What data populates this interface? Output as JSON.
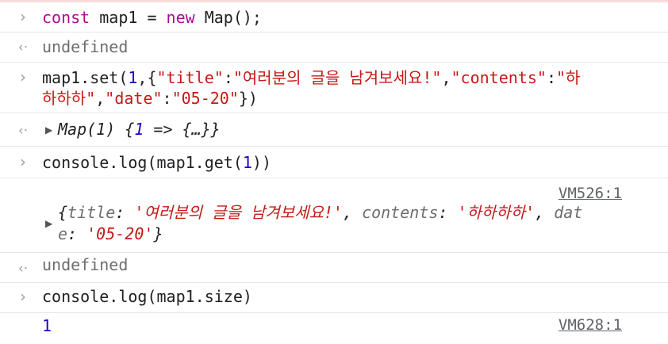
{
  "rows": [
    {
      "type": "input",
      "text_parts": [
        "const",
        " map1 = ",
        "new",
        " Map();"
      ]
    },
    {
      "type": "output",
      "text": "undefined"
    },
    {
      "type": "input",
      "line1_parts": [
        "map1.set(",
        "1",
        ",{",
        "\"title\"",
        ":",
        "\"여러분의 글을 남겨보세요!\"",
        ",",
        "\"contents\"",
        ":",
        "\"하"
      ],
      "line2_parts": [
        "하하하\"",
        ",",
        "\"date\"",
        ":",
        "\"05-20\"",
        "})"
      ]
    },
    {
      "type": "output",
      "parts": [
        "Map(1) {",
        "1",
        " => {…}}"
      ]
    },
    {
      "type": "input",
      "parts": [
        "console.log(map1.get(",
        "1",
        "))"
      ]
    },
    {
      "type": "log",
      "source": "VM526:1",
      "line1_parts": [
        "{",
        "title",
        ": ",
        "'여러분의 글을 남겨보세요!'",
        ", ",
        "contents",
        ": ",
        "'하하하하'",
        ", ",
        "dat"
      ],
      "line2_parts": [
        "e",
        ": ",
        "'05-20'",
        "}"
      ]
    },
    {
      "type": "output",
      "text": "undefined"
    },
    {
      "type": "input",
      "text": "console.log(map1.size)"
    },
    {
      "type": "log",
      "value": "1",
      "source": "VM628:1"
    }
  ],
  "icons": {
    "prompt": "›",
    "return": "‹·",
    "expand": "▶"
  }
}
